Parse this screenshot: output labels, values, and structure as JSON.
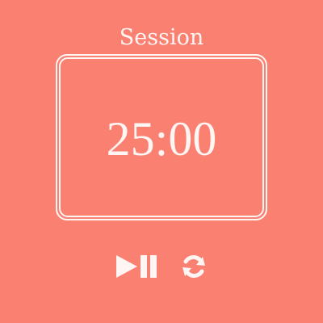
{
  "session": {
    "label": "Session",
    "time": "25:00"
  },
  "controls": {
    "play_pause_icon": "play-pause-icon",
    "reset_icon": "refresh-icon"
  },
  "colors": {
    "background": "#FA8072",
    "foreground": "#FFF5F2"
  }
}
